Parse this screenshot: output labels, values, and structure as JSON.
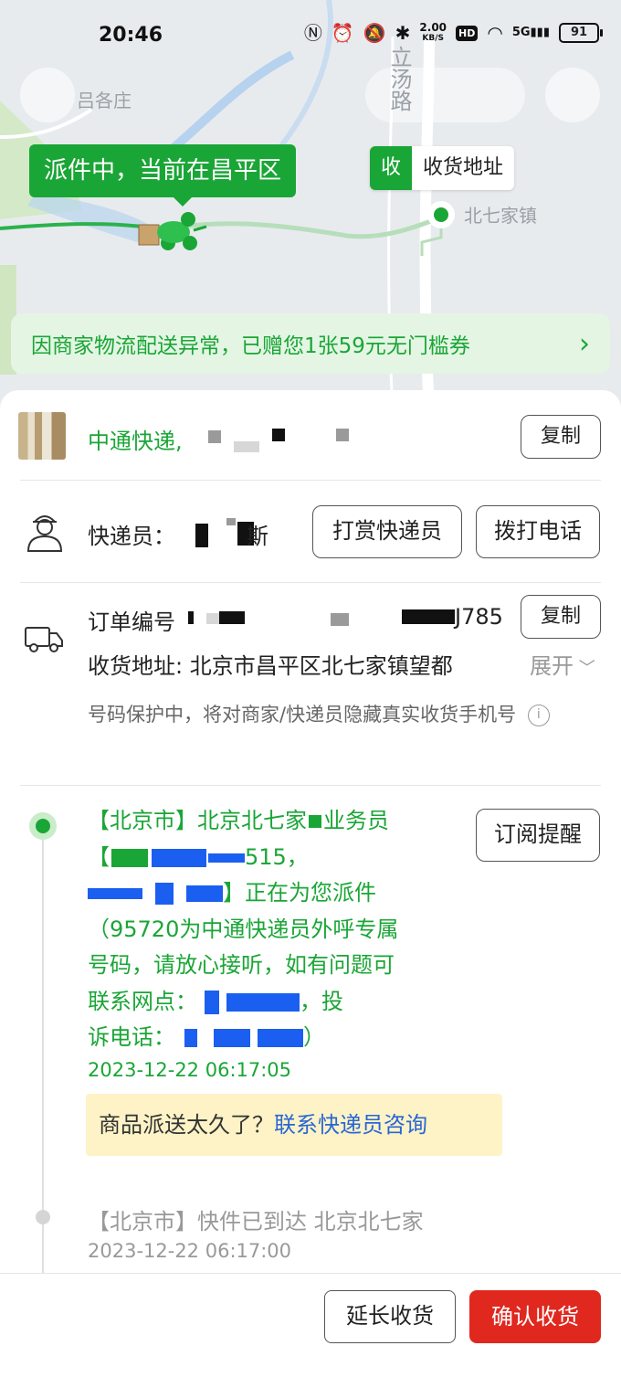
{
  "status_bar": {
    "time": "20:46",
    "network_speed": "2.00",
    "speed_unit": "KB/S",
    "hd": "HD",
    "network": "5G",
    "battery": "91"
  },
  "map": {
    "place_labels": [
      "吕各庄",
      "立汤路",
      "北七家镇"
    ],
    "delivery_bubble": "派件中，当前在昌平区",
    "address_tag_key": "收",
    "address_tag_label": "收货地址"
  },
  "coupon": {
    "text": "因商家物流配送异常，已赠您1张59元无门槛券",
    "arrow": "›"
  },
  "shipment": {
    "courier_company": "中通快递",
    "copy_label": "复制",
    "courier_label": "快递员：",
    "courier_name_visible": "斯",
    "tip_button": "打赏快递员",
    "call_button": "拨打电话",
    "order_label": "订单编号",
    "order_suffix": "J785",
    "order_copy_label": "复制",
    "address_label": "收货地址: ",
    "address_value": "北京市昌平区北七家镇望都",
    "expand_label": "展开",
    "privacy_notice": "号码保护中，将对商家/快递员隐藏真实收货手机号",
    "info_icon": "i"
  },
  "timeline": {
    "subscribe_button": "订阅提醒",
    "latest": {
      "line1": "【北京市】北京北七家",
      "line1b": "业务员",
      "line2": "【",
      "line2b": "515，",
      "line3": "】正在为您派件",
      "line4": "（95720为中通快递员外呼专属",
      "line5": "号码，请放心接听，如有问题可",
      "line6a": "联系网点：",
      "line6b": "，投",
      "line7a": "诉电话：",
      "line7b": "）",
      "time": "2023-12-22 06:17:05"
    },
    "notice_text": "商品派送太久了？",
    "notice_link": "联系快递员咨询",
    "previous": {
      "text": "【北京市】快件已到达 北京北七家",
      "time": "2023-12-22 06:17:00"
    }
  },
  "bottom_bar": {
    "extend_button": "延长收货",
    "confirm_button": "确认收货"
  },
  "colors": {
    "brand_green": "#1aa636",
    "confirm_red": "#e0281f",
    "link_blue": "#2966d6",
    "notice_yellow": "#fdf3c6"
  }
}
